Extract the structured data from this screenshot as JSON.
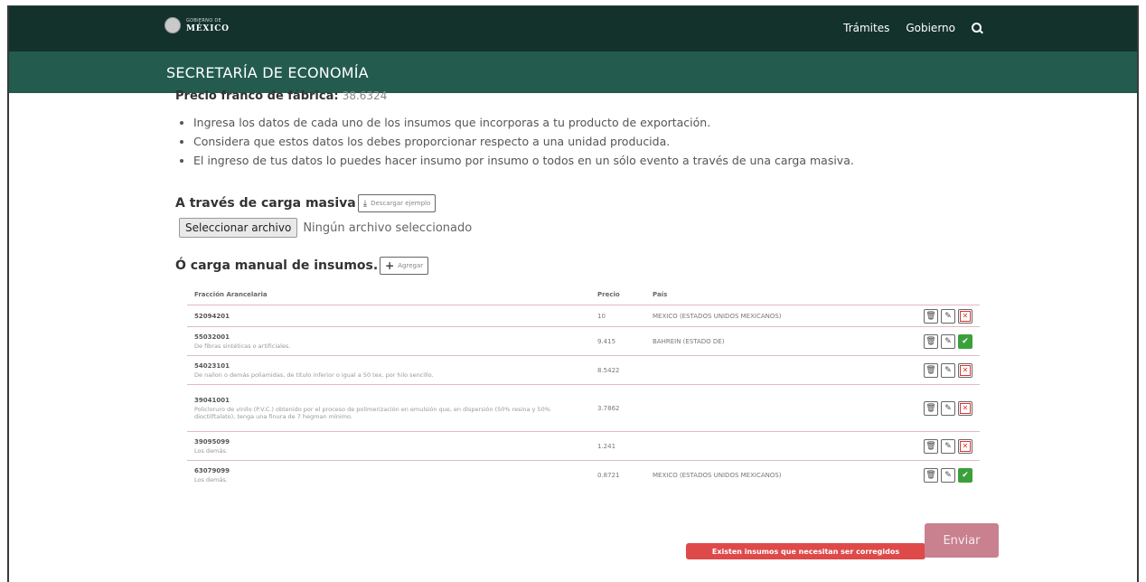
{
  "header": {
    "logo_small": "GOBIERNO DE",
    "logo_main": "MÉXICO",
    "nav": [
      "Trámites",
      "Gobierno"
    ],
    "search_icon": "search-icon"
  },
  "subheader": {
    "title": "SECRETARÍA DE ECONOMÍA"
  },
  "precio": {
    "label": "Precio franco de fábrica:",
    "value": "38.6324"
  },
  "instructions": [
    "Ingresa los datos de cada uno de los insumos que incorporas a tu producto de exportación.",
    "Considera que estos datos los debes proporcionar respecto a una unidad producida.",
    "El ingreso de tus datos lo puedes hacer insumo por insumo o todos en un sólo evento a través de una carga masiva."
  ],
  "carga_masiva": {
    "label": "A través de carga masiva",
    "download_button": "Descargar ejemplo",
    "file_button": "Seleccionar archivo",
    "file_status": "Ningún archivo seleccionado"
  },
  "carga_manual": {
    "label": "Ó carga manual de insumos.",
    "add_button": "Agregar"
  },
  "table": {
    "headers": [
      "Fracción Arancelaria",
      "Precio",
      "País"
    ],
    "rows": [
      {
        "fraccion": "52094201",
        "desc": "",
        "precio": "10",
        "pais": "MEXICO (ESTADOS UNIDOS MEXICANOS)",
        "status": "error"
      },
      {
        "fraccion": "55032001",
        "desc": "De fibras sintéticas o artificiales.",
        "precio": "9.415",
        "pais": "BAHREIN (ESTADO DE)",
        "status": "ok"
      },
      {
        "fraccion": "54023101",
        "desc": "De nailon o demás poliamidas, de título inferior o igual a 50 tex, por hilo sencillo.",
        "precio": "8.5422",
        "pais": "",
        "status": "error"
      },
      {
        "fraccion": "39041001",
        "desc": "Policloruro de vinilo (P.V.C.) obtenido por el proceso de polimerización en emulsión que, en dispersión (50% resina y 50% dioctilftalato), tenga una finura de 7 hegman mínimo.",
        "precio": "3.7862",
        "pais": "",
        "status": "error"
      },
      {
        "fraccion": "39095099",
        "desc": "Los demás.",
        "precio": "1.241",
        "pais": "",
        "status": "error"
      },
      {
        "fraccion": "63079099",
        "desc": "Los demás.",
        "precio": "0.8721",
        "pais": "MEXICO (ESTADOS UNIDOS MEXICANOS)",
        "status": "ok"
      }
    ]
  },
  "alert": "Existen insumos que necesitan ser corregidos",
  "submit": "Enviar",
  "colors": {
    "header": "#13322b",
    "subheader": "#235b4e",
    "alert": "#de4a4a",
    "submit": "#c9808f",
    "ok": "#3ba03b"
  }
}
